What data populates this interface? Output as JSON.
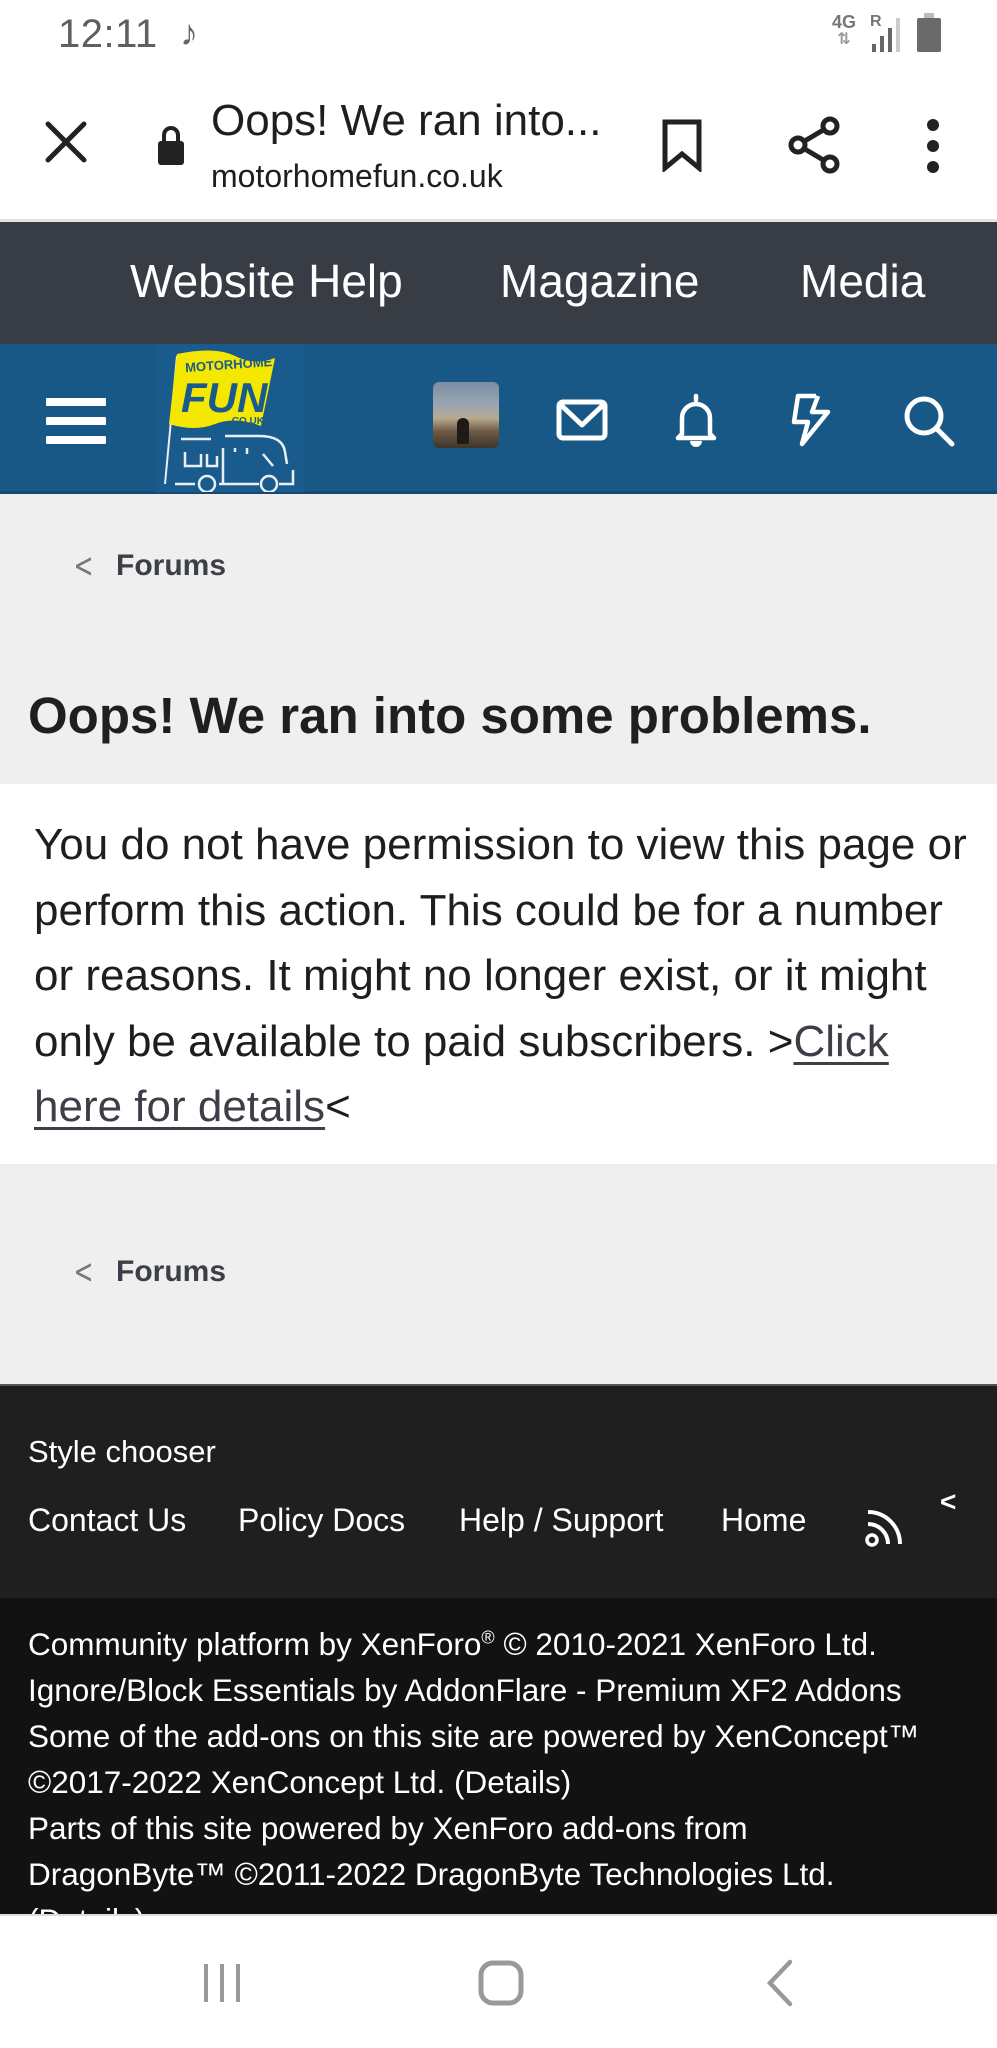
{
  "status_bar": {
    "time": "12:11",
    "notification_icon": "music-note-icon",
    "network_type": "4G",
    "roaming": "R",
    "signal_icon": "signal-icon",
    "battery_icon": "battery-icon"
  },
  "browser": {
    "close_icon": "close-icon",
    "lock_icon": "lock-icon",
    "page_title": "Oops! We ran into...",
    "url": "motorhomefun.co.uk",
    "bookmark_icon": "bookmark-icon",
    "share_icon": "share-icon",
    "more_icon": "more-vert-icon"
  },
  "site_nav": {
    "items": [
      {
        "label": "Website Help"
      },
      {
        "label": "Magazine"
      },
      {
        "label": "Media"
      }
    ]
  },
  "site_header": {
    "logo_text_top": "MOTORHOME",
    "logo_text_main": "FUN",
    "logo_text_domain": ".CO.UK",
    "icons": [
      "menu-icon",
      "avatar",
      "inbox-icon",
      "bell-icon",
      "whats-new-icon",
      "search-icon"
    ]
  },
  "breadcrumb": {
    "label": "Forums"
  },
  "error": {
    "title": "Oops! We ran into some problems.",
    "message_before": "You do not have permission to view this page or perform this action. This could be for a number or reasons. It might no longer exist, or it might only be available to paid subscribers. >",
    "link_text": "Click here for details",
    "message_after": "<"
  },
  "footer": {
    "style_chooser": "Style chooser",
    "links": [
      {
        "label": "Contact Us"
      },
      {
        "label": "Policy Docs"
      },
      {
        "label": "Help / Support"
      },
      {
        "label": "Home"
      }
    ],
    "rss_icon": "rss-icon",
    "collapse_label": "<"
  },
  "copyright": {
    "lines": [
      "Community platform by XenForo",
      "Ignore/Block Essentials by AddonFlare - Premium XF2 Addons",
      "Some of the add-ons on this site are powered by XenConcept™",
      "©2017-2022 XenConcept Ltd. (Details)",
      "Parts of this site powered by XenForo add-ons from",
      "DragonByte™ ©2011-2022 DragonByte Technologies Ltd.",
      "(Details)"
    ],
    "line1_suffix": " © 2010-2021 XenForo Ltd.",
    "registered_mark": "®"
  },
  "android_nav": {
    "recents_icon": "recents-icon",
    "home_icon": "home-icon",
    "back_icon": "back-icon"
  },
  "colors": {
    "nav_bar": "#383c45",
    "header": "#185886",
    "logo_yellow": "#f4e800",
    "content_bg": "#efefef",
    "footer": "#1f1f1f",
    "copyright_bg": "#121212"
  }
}
